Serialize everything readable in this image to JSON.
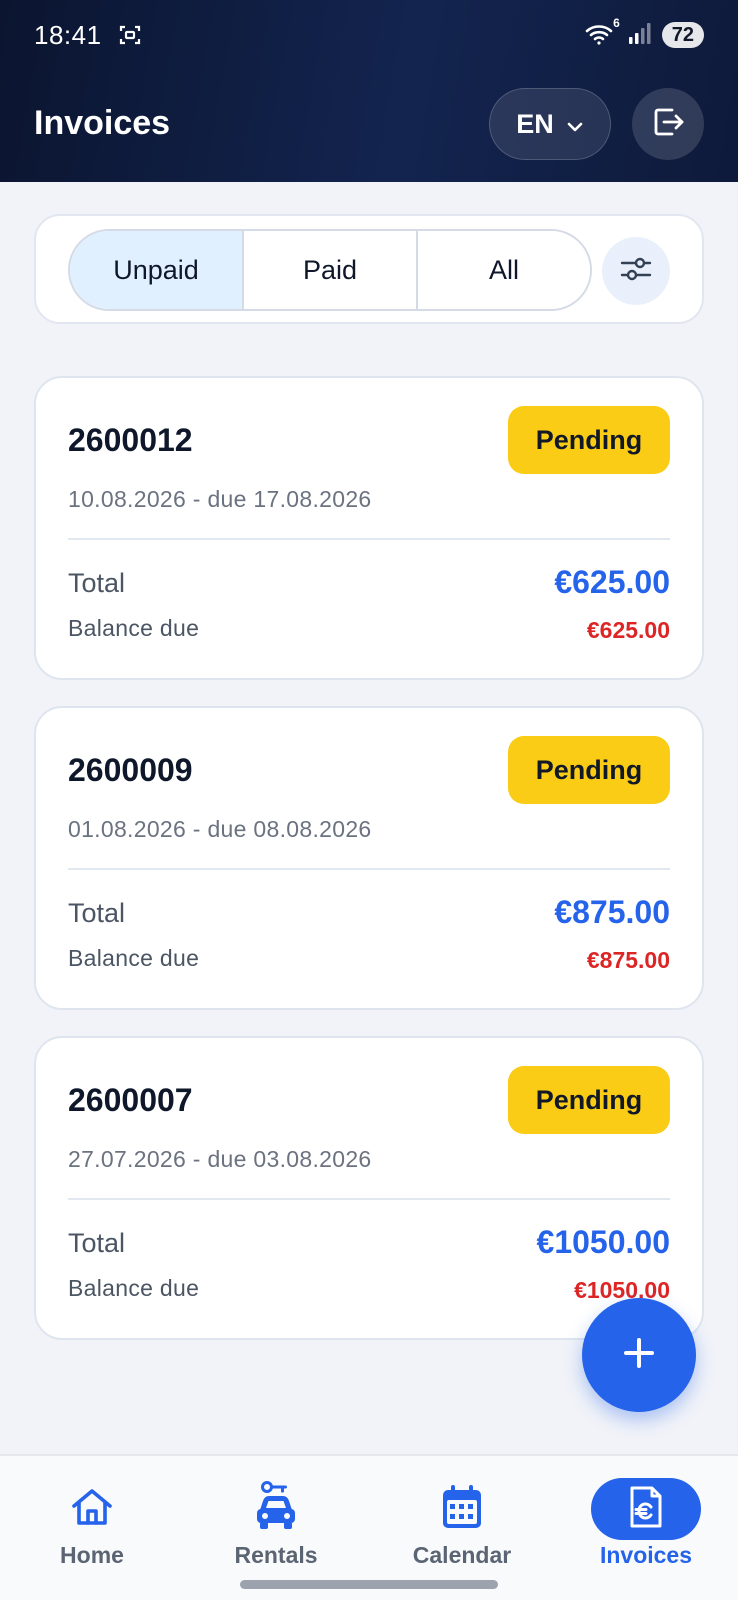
{
  "status_bar": {
    "time": "18:41",
    "wifi_badge": "6",
    "battery": "72"
  },
  "header": {
    "title": "Invoices",
    "language": "EN"
  },
  "filter": {
    "segments": [
      "Unpaid",
      "Paid",
      "All"
    ],
    "active": "Unpaid"
  },
  "invoices": [
    {
      "number": "2600012",
      "status": "Pending",
      "dates": "10.08.2026 - due 17.08.2026",
      "total_label": "Total",
      "total": "€625.00",
      "balance_label": "Balance due",
      "balance": "€625.00"
    },
    {
      "number": "2600009",
      "status": "Pending",
      "dates": "01.08.2026 - due 08.08.2026",
      "total_label": "Total",
      "total": "€875.00",
      "balance_label": "Balance due",
      "balance": "€875.00"
    },
    {
      "number": "2600007",
      "status": "Pending",
      "dates": "27.07.2026 - due 03.08.2026",
      "total_label": "Total",
      "total": "€1050.00",
      "balance_label": "Balance due",
      "balance": "€1050.00"
    }
  ],
  "nav": {
    "items": [
      {
        "label": "Home",
        "icon": "home-icon"
      },
      {
        "label": "Rentals",
        "icon": "car-key-icon"
      },
      {
        "label": "Calendar",
        "icon": "calendar-icon"
      },
      {
        "label": "Invoices",
        "icon": "invoice-icon"
      }
    ],
    "active": "Invoices"
  },
  "colors": {
    "primary": "#2563eb",
    "pending": "#facc15",
    "balance": "#dc2626",
    "header_dark": "#0b1530"
  }
}
